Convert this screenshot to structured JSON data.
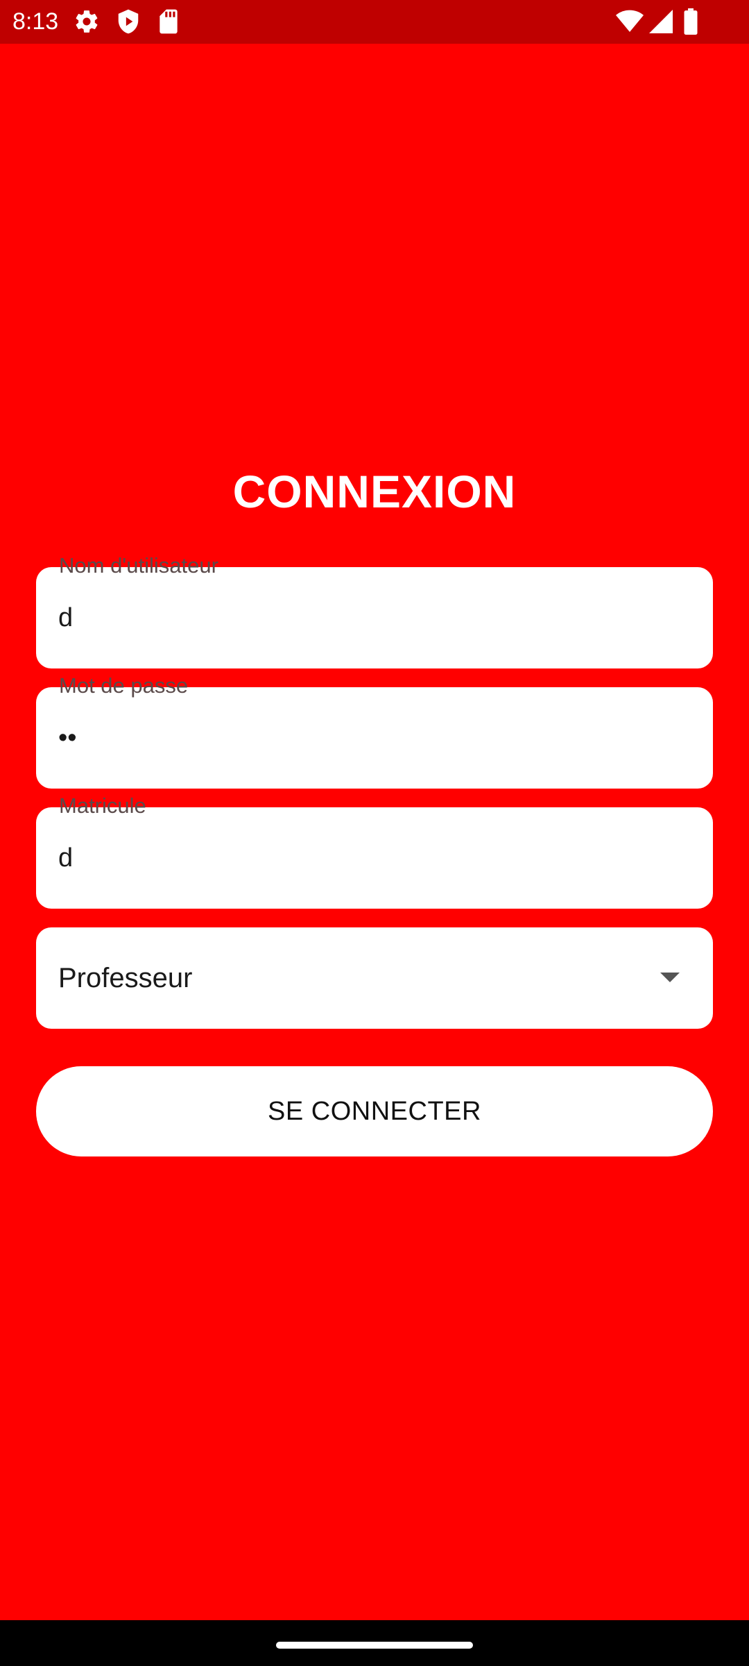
{
  "status_bar": {
    "time": "8:13",
    "icons": [
      "settings-icon",
      "shield-play-icon",
      "sd-card-icon",
      "wifi-icon",
      "signal-icon",
      "battery-icon"
    ]
  },
  "login": {
    "title": "CONNEXION",
    "username": {
      "label": "Nom d'utilisateur",
      "value": "d"
    },
    "password": {
      "label": "Mot de passe",
      "value": "••"
    },
    "matricule": {
      "label": "Matricule",
      "value": "d"
    },
    "role": {
      "selected": "Professeur"
    },
    "submit_label": "SE CONNECTER"
  },
  "colors": {
    "background": "#ff0000",
    "status_bar": "#bf0000",
    "field": "#ffffff"
  }
}
